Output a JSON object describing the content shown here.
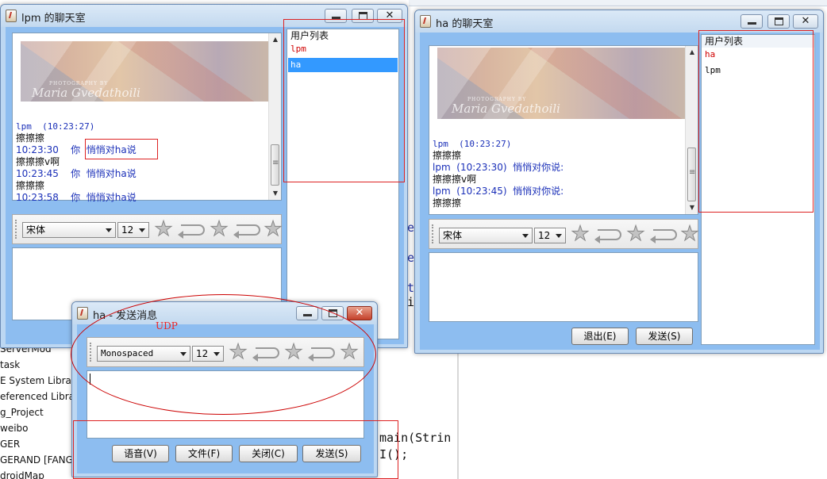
{
  "background": {
    "tree_items": [
      "ServerMod",
      "task",
      "E System Librar",
      "eferenced Librar",
      "g_Project",
      "weibo",
      "GER",
      "GERAND [FANGE",
      "droidMap"
    ],
    "code_fragments": [
      "e",
      "e",
      "t",
      "i",
      "main(Strin",
      "I();"
    ]
  },
  "window_lpm": {
    "title": "lpm 的聊天室",
    "photo_caption": "PHOTOGRAPHY BY",
    "photo_name": "Maria Gvedathoili",
    "messages": [
      {
        "text": "lpm  (10:23:27)",
        "style": "blue"
      },
      {
        "text": "擦擦擦",
        "style": "blk"
      },
      {
        "text": "10:23:30    你  悄悄对ha说",
        "style": "blue"
      },
      {
        "text": "擦擦擦v啊",
        "style": "blk"
      },
      {
        "text": "10:23:45    你  悄悄对ha说",
        "style": "blue"
      },
      {
        "text": "擦擦擦",
        "style": "blk"
      },
      {
        "text": "10:23:58    你  悄悄对ha说",
        "style": "blue"
      }
    ],
    "font_value": "宋体",
    "size_value": "12",
    "user_list_header": "用户列表",
    "users": [
      "lpm",
      "ha"
    ]
  },
  "window_ha": {
    "title": "ha 的聊天室",
    "photo_caption": "PHOTOGRAPHY BY",
    "photo_name": "Maria Gvedathoili",
    "messages": [
      {
        "text": "lpm  (10:23:27)",
        "style": "blue"
      },
      {
        "text": "擦擦擦",
        "style": "blk"
      },
      {
        "text": "lpm  (10:23:30)  悄悄对你说:",
        "style": "blue"
      },
      {
        "text": "擦擦擦v啊",
        "style": "blk"
      },
      {
        "text": "lpm  (10:23:45)  悄悄对你说:",
        "style": "blue"
      },
      {
        "text": "擦擦擦",
        "style": "blk"
      }
    ],
    "font_value": "宋体",
    "size_value": "12",
    "user_list_header": "用户列表",
    "users": [
      "ha",
      "lpm"
    ],
    "exit_button": "退出(E)",
    "send_button": "发送(S)"
  },
  "window_send": {
    "title": "ha - 发送消息",
    "font_value": "Monospaced",
    "size_value": "12",
    "voice_button": "语音(V)",
    "file_button": "文件(F)",
    "close_button": "关闭(C)",
    "send_button": "发送(S)"
  },
  "annotations": {
    "udp_label": "UDP"
  },
  "colors": {
    "window_frame": "#bcd7f2",
    "inner_frame": "#8dbdf0",
    "selection": "#3399ff",
    "message_blue": "#1a2fb8",
    "annotation_red": "#dd2222"
  }
}
